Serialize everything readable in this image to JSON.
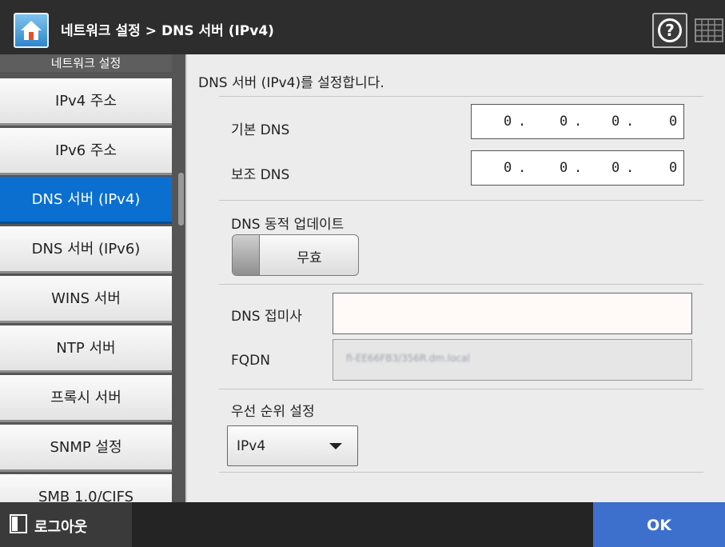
{
  "header": {
    "breadcrumb_parent": "네트워크 설정",
    "breadcrumb_separator": ">",
    "breadcrumb_current": "DNS 서버 (IPv4)",
    "home_icon": "home-icon",
    "help_icon": "help-icon",
    "help_glyph": "?",
    "keyboard_icon": "keyboard-icon"
  },
  "sidebar": {
    "title": "네트워크 설정",
    "items": [
      {
        "label": "IPv4 주소"
      },
      {
        "label": "IPv6 주소"
      },
      {
        "label": "DNS 서버 (IPv4)"
      },
      {
        "label": "DNS 서버 (IPv6)"
      },
      {
        "label": "WINS 서버"
      },
      {
        "label": "NTP 서버"
      },
      {
        "label": "프록시 서버"
      },
      {
        "label": "SNMP 설정"
      },
      {
        "label": "SMB 1.0/CIFS"
      }
    ],
    "active_index": 2
  },
  "main": {
    "description": "DNS 서버 (IPv4)를 설정합니다.",
    "primary_dns": {
      "label": "기본 DNS",
      "octets": [
        "0",
        "0",
        "0",
        "0"
      ]
    },
    "secondary_dns": {
      "label": "보조 DNS",
      "octets": [
        "0",
        "0",
        "0",
        "0"
      ]
    },
    "octet_separator": ".",
    "dynamic_update": {
      "label": "DNS 동적 업데이트",
      "value": "무효"
    },
    "dns_suffix": {
      "label": "DNS 접미사",
      "value": ""
    },
    "fqdn": {
      "label": "FQDN",
      "value": "fi-EE66FB3/356R.dm.local"
    },
    "priority": {
      "label": "우선 순위 설정",
      "value": "IPv4"
    }
  },
  "footer": {
    "logout_label": "로그아웃",
    "ok_label": "OK"
  },
  "colors": {
    "header_bg": "#2d2d2d",
    "active_nav": "#0a6fcf",
    "ok_button": "#3d6fcc",
    "content_bg": "#ececec"
  }
}
